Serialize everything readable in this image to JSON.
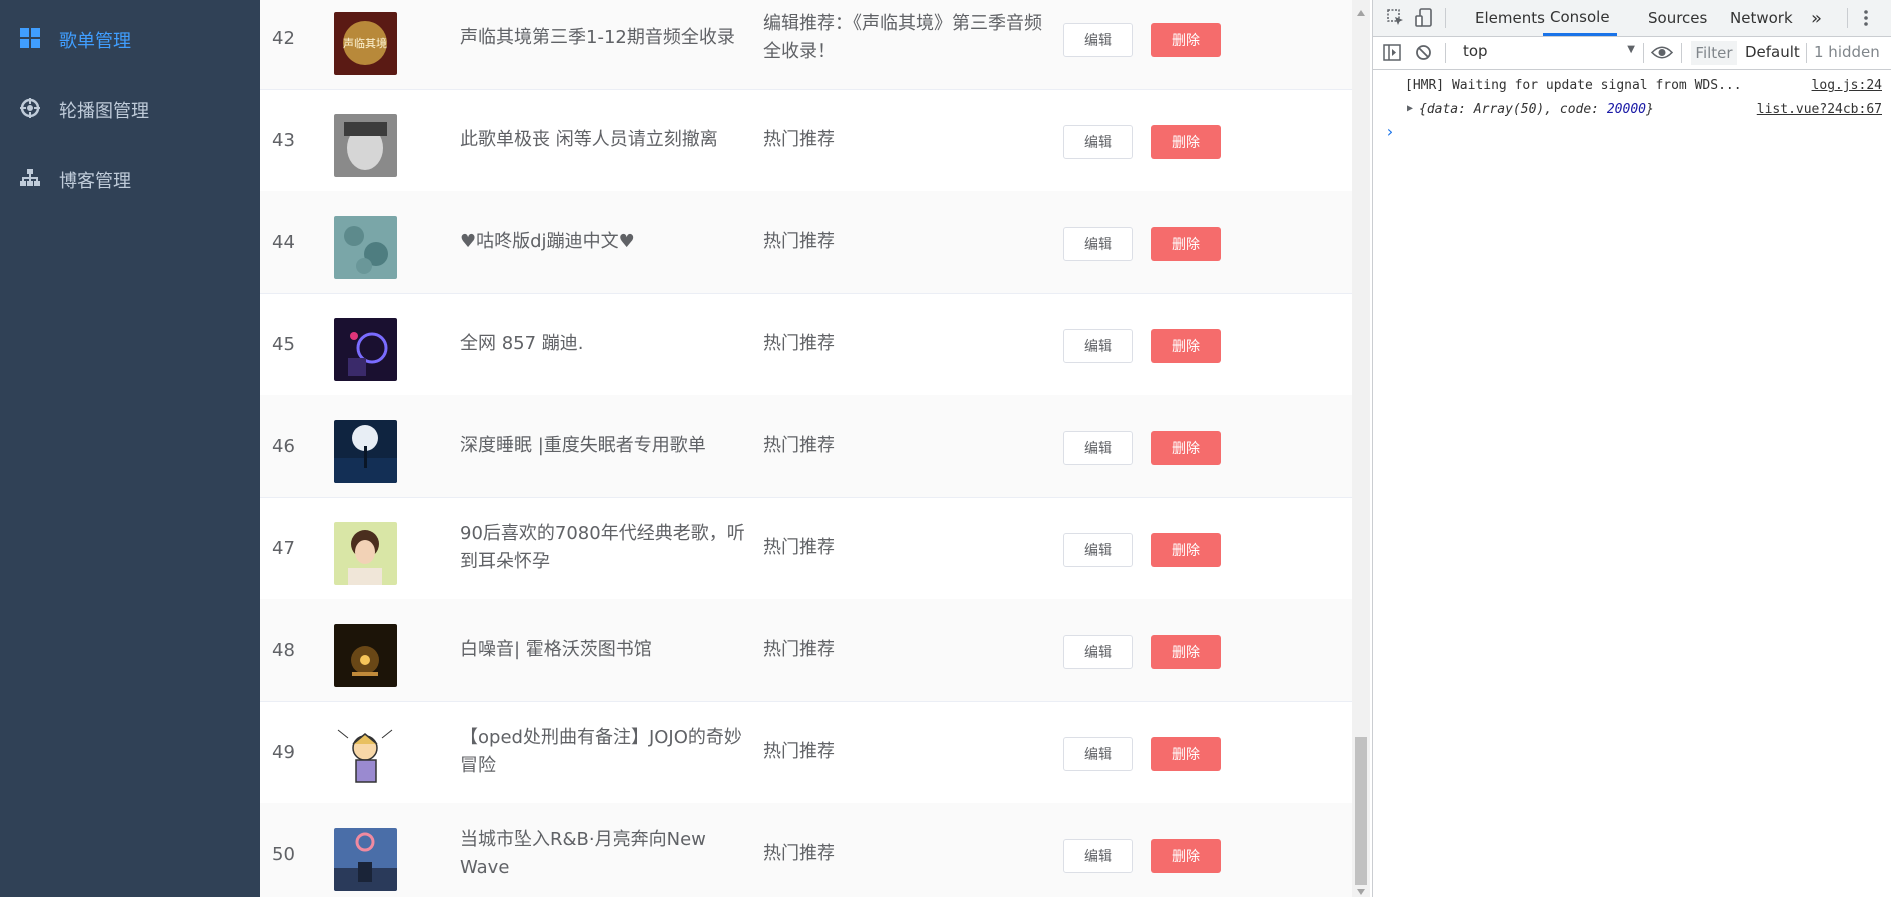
{
  "sidebar": {
    "items": [
      {
        "label": "歌单管理",
        "icon": "grid-icon",
        "active": true
      },
      {
        "label": "轮播图管理",
        "icon": "carousel-icon",
        "active": false
      },
      {
        "label": "博客管理",
        "icon": "sitemap-icon",
        "active": false
      }
    ]
  },
  "table": {
    "rows": [
      {
        "id": "42",
        "name": "声临其境第三季1-12期音频全收录",
        "desc": "编辑推荐：《声临其境》第三季音频全收录！",
        "thumb": "cover-42"
      },
      {
        "id": "43",
        "name": "此歌单极丧 闲等人员请立刻撤离",
        "desc": "热门推荐",
        "thumb": "cover-43"
      },
      {
        "id": "44",
        "name": "♥咕咚版dj蹦迪中文♥",
        "desc": "热门推荐",
        "thumb": "cover-44"
      },
      {
        "id": "45",
        "name": "全网 857 蹦迪.",
        "desc": "热门推荐",
        "thumb": "cover-45"
      },
      {
        "id": "46",
        "name": "深度睡眠 |重度失眠者专用歌单",
        "desc": "热门推荐",
        "thumb": "cover-46"
      },
      {
        "id": "47",
        "name": "90后喜欢的7080年代经典老歌，听到耳朵怀孕",
        "desc": "热门推荐",
        "thumb": "cover-47"
      },
      {
        "id": "48",
        "name": "白噪音| 霍格沃茨图书馆",
        "desc": "热门推荐",
        "thumb": "cover-48"
      },
      {
        "id": "49",
        "name": "【oped处刑曲有备注】JOJO的奇妙冒险",
        "desc": "热门推荐",
        "thumb": "cover-49"
      },
      {
        "id": "50",
        "name": "当城市坠入R&B·月亮奔向New Wave",
        "desc": "热门推荐",
        "thumb": "cover-50"
      }
    ],
    "edit_label": "编辑",
    "delete_label": "删除"
  },
  "devtools": {
    "tabs": [
      "Elements",
      "Console",
      "Sources",
      "Network"
    ],
    "active_tab": "Console",
    "more_tabs": "»",
    "context": "top",
    "filter_placeholder": "Filter",
    "levels": "Default",
    "hidden": "1 hidden",
    "console_lines": [
      {
        "text": "[HMR] Waiting for update signal from WDS...",
        "source": "log.js:24"
      },
      {
        "text_prefix": "{data: Array(50), code: ",
        "text_num": "20000",
        "text_suffix": "}",
        "source": "list.vue?24cb:67"
      }
    ],
    "prompt": "›"
  },
  "colors": {
    "sidebar_bg": "#304156",
    "active": "#409eff",
    "danger": "#f56c6c",
    "devtools_accent": "#1a73e8"
  }
}
